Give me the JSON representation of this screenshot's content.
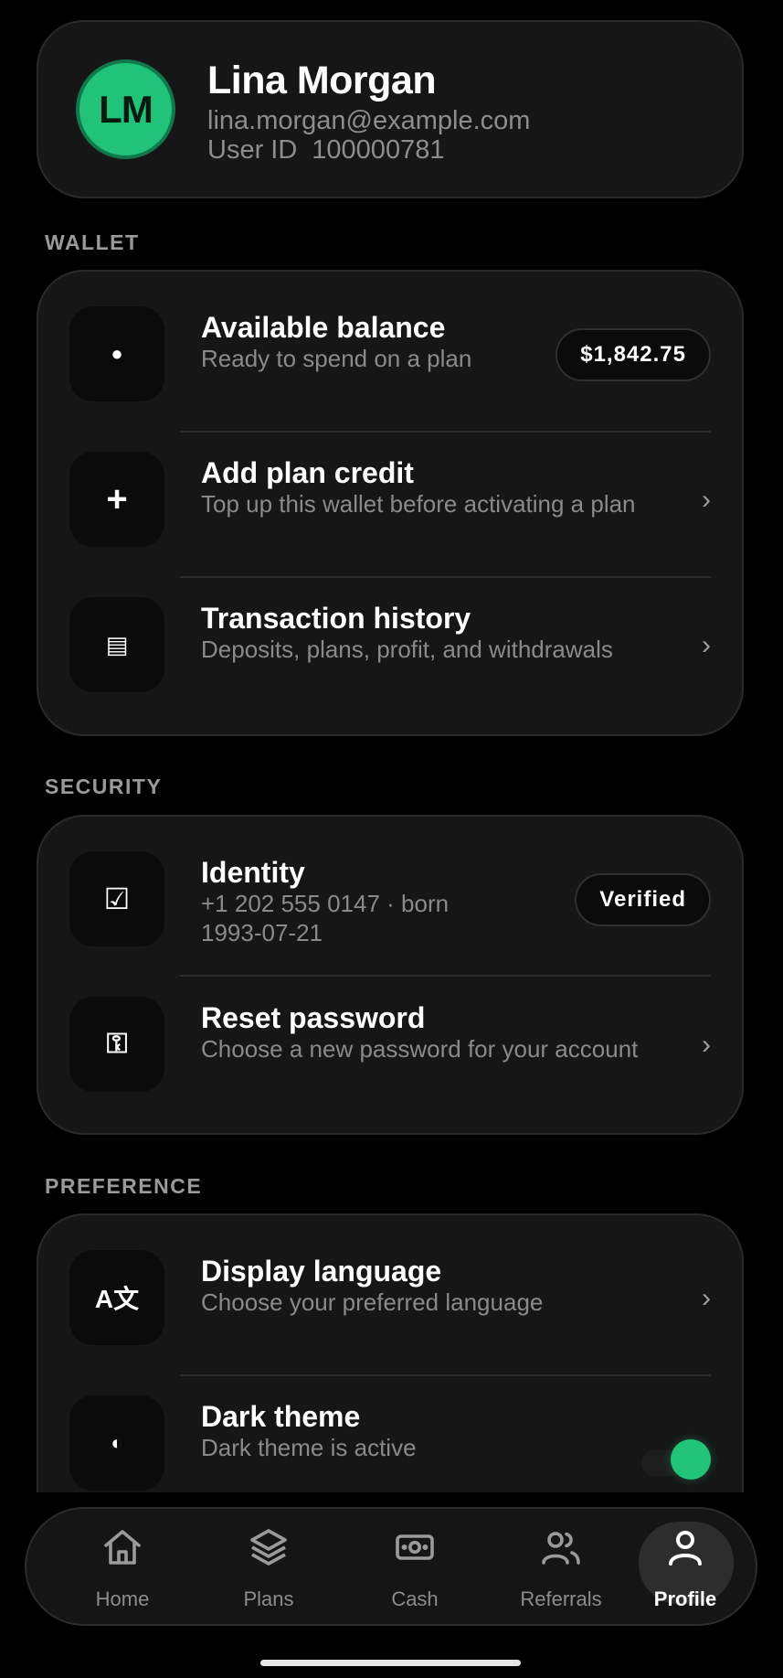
{
  "profile": {
    "initials": "LM",
    "name": "Lina Morgan",
    "email": "lina.morgan@example.com",
    "user_id_label": "User ID",
    "user_id": "100000781"
  },
  "wallet": {
    "section_label": "WALLET",
    "rows": [
      {
        "icon": "dot-icon",
        "glyph": "●",
        "title": "Available balance",
        "subtitle": "Ready to spend on a plan",
        "badge": "$1,842.75"
      },
      {
        "icon": "plus-icon",
        "glyph": "+",
        "title": "Add plan credit",
        "subtitle": "Top up this wallet before activating a plan",
        "chevron": "›"
      },
      {
        "icon": "list-icon",
        "glyph": "▤",
        "title": "Transaction history",
        "subtitle": "Deposits, plans, profit, and withdrawals",
        "chevron": "›"
      }
    ]
  },
  "security": {
    "section_label": "SECURITY",
    "rows": [
      {
        "icon": "checkbox-icon",
        "glyph": "☑",
        "title": "Identity",
        "subtitle_line1": "+1 202 555 0147 · born",
        "subtitle_line2": "1993-07-21",
        "badge": "Verified"
      },
      {
        "icon": "key-icon",
        "glyph": "⚿",
        "title": "Reset password",
        "subtitle": "Choose a new password for your account",
        "chevron": "›"
      }
    ]
  },
  "preference": {
    "section_label": "PREFERENCE",
    "rows": [
      {
        "icon": "translate-icon",
        "glyph": "A文",
        "title": "Display language",
        "subtitle": "Choose your preferred language",
        "chevron": "›"
      },
      {
        "icon": "contrast-icon",
        "glyph": "◐",
        "title": "Dark theme",
        "subtitle": "Dark theme is active",
        "toggle_on": true
      }
    ]
  },
  "nav": {
    "items": [
      {
        "label": "Home",
        "icon": "home-icon"
      },
      {
        "label": "Plans",
        "icon": "layers-icon"
      },
      {
        "label": "Cash",
        "icon": "cash-icon"
      },
      {
        "label": "Referrals",
        "icon": "users-icon"
      },
      {
        "label": "Profile",
        "icon": "user-icon",
        "active": true
      }
    ]
  },
  "colors": {
    "accent": "#21c27a",
    "background": "#000000",
    "card": "#161616",
    "muted_text": "#8a8a8a"
  }
}
